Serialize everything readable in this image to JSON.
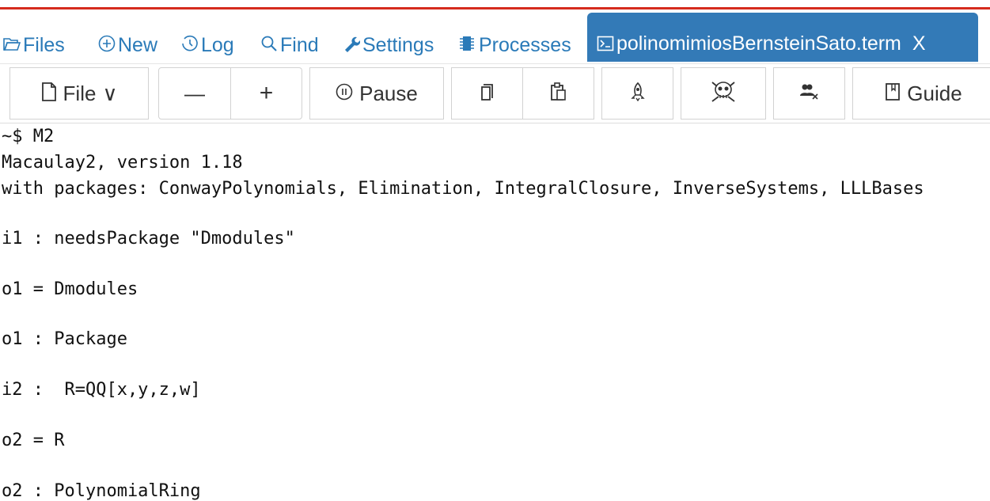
{
  "tabs": {
    "files": {
      "icon": "folder-open-icon",
      "label": "Files"
    },
    "new": {
      "icon": "plus-circle-icon",
      "label": "New"
    },
    "log": {
      "icon": "history-icon",
      "label": "Log"
    },
    "find": {
      "icon": "search-icon",
      "label": "Find"
    },
    "settings": {
      "icon": "wrench-icon",
      "label": "Settings"
    },
    "processes": {
      "icon": "microchip-icon",
      "label": "Processes"
    },
    "active": {
      "icon": "terminal-icon",
      "label": "polinomimiosBernsteinSato.term",
      "close": "X"
    }
  },
  "toolbar": {
    "file_label": "File",
    "file_caret": "∨",
    "zoom_out": "—",
    "zoom_in": "+",
    "pause_label": "Pause",
    "guide_label": "Guide"
  },
  "terminal": {
    "lines": [
      "~$ M2",
      "Macaulay2, version 1.18",
      "with packages: ConwayPolynomials, Elimination, IntegralClosure, InverseSystems, LLLBases",
      "i1 : needsPackage \"Dmodules\"",
      "o1 = Dmodules",
      "o1 : Package",
      "i2 :  R=QQ[x,y,z,w]",
      "o2 = R",
      "o2 : PolynomialRing"
    ]
  },
  "colors": {
    "accent": "#337ab7",
    "link": "#2a7ab8",
    "rule": "#d52b1e"
  }
}
